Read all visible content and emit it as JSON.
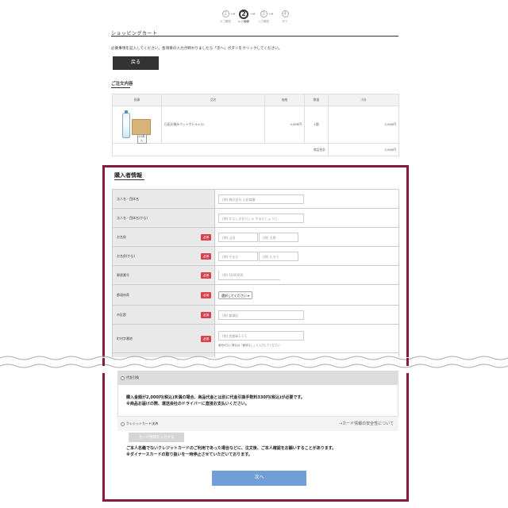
{
  "steps": [
    {
      "num": "1",
      "label": "カゴ確認"
    },
    {
      "num": "2",
      "label": "レジ画面"
    },
    {
      "num": "3",
      "label": "入力確認"
    },
    {
      "num": "4",
      "label": "完了"
    }
  ],
  "step_arrow": "→",
  "header": {
    "title": "ショッピングカート"
  },
  "notice": "必要事項を記入してください。各項目の入力が終わりましたら「次へ」ボタンをクリックしてください。",
  "back_button": "戻る",
  "order": {
    "title": "ご注文内容",
    "headers": [
      "画像",
      "品名",
      "価格",
      "数量",
      "小計"
    ],
    "product_badge": "10本入",
    "name": "日田天領水ペットボトル×15",
    "price": "3,990円",
    "qty": "1個",
    "subtotal": "3,990円",
    "total_label": "商品合計",
    "total": "3,990円"
  },
  "buyer": {
    "title": "購入者情報",
    "required_label": "必須",
    "company": {
      "label": "法人名・団体名",
      "placeholder": "(例) 株式会社 山田商事"
    },
    "company_kana": {
      "label": "法人名・団体名(かな)",
      "placeholder": "(例) かぶしきがいしゃ やまだしょうじ"
    },
    "name": {
      "label": "お名前",
      "last_placeholder": "(例) 山田",
      "first_placeholder": "(例) 太郎"
    },
    "name_kana": {
      "label": "お名前(かな)",
      "last_placeholder": "(例) やまだ",
      "first_placeholder": "(例) たろう"
    },
    "zip": {
      "label": "郵便番号",
      "placeholder": "(例) 1000000"
    },
    "pref": {
      "label": "都道府県",
      "select": "選択してください ▾"
    },
    "city": {
      "label": "市区郡",
      "placeholder": "(例) 都城区"
    },
    "town": {
      "label": "町村字番地",
      "placeholder": "(例) 西都新1-1-1",
      "hint": "番地がない場合は「番地なし」と入力してください"
    }
  },
  "payment": {
    "cod_label": "代金引換",
    "cod_text_1": "購入金額が2,000円(税込)未満の場合、商品代金とは別に代金引換手数料330円(税込)が必要です。",
    "cod_text_2": "※商品お届けの際、運送会社のドライバーに直接お支払いください。",
    "cc_label": "クレジットカード決済",
    "cc_link": "→カード情報の安全性について",
    "cc_button": "カード情報を入力する",
    "cc_text_1": "ご本人名義でないクレジットカードのご利用であった場合などに、注文後、ご本人確認をお願いすることがあります。",
    "cc_text_2": "※ダイナースカードの取り扱いを一時停止させていただいております。"
  },
  "next_button": "次へ",
  "colors": {
    "frame": "#8b1a3a",
    "required": "#d9434f",
    "next": "#6f9fd6",
    "back": "#333333"
  }
}
